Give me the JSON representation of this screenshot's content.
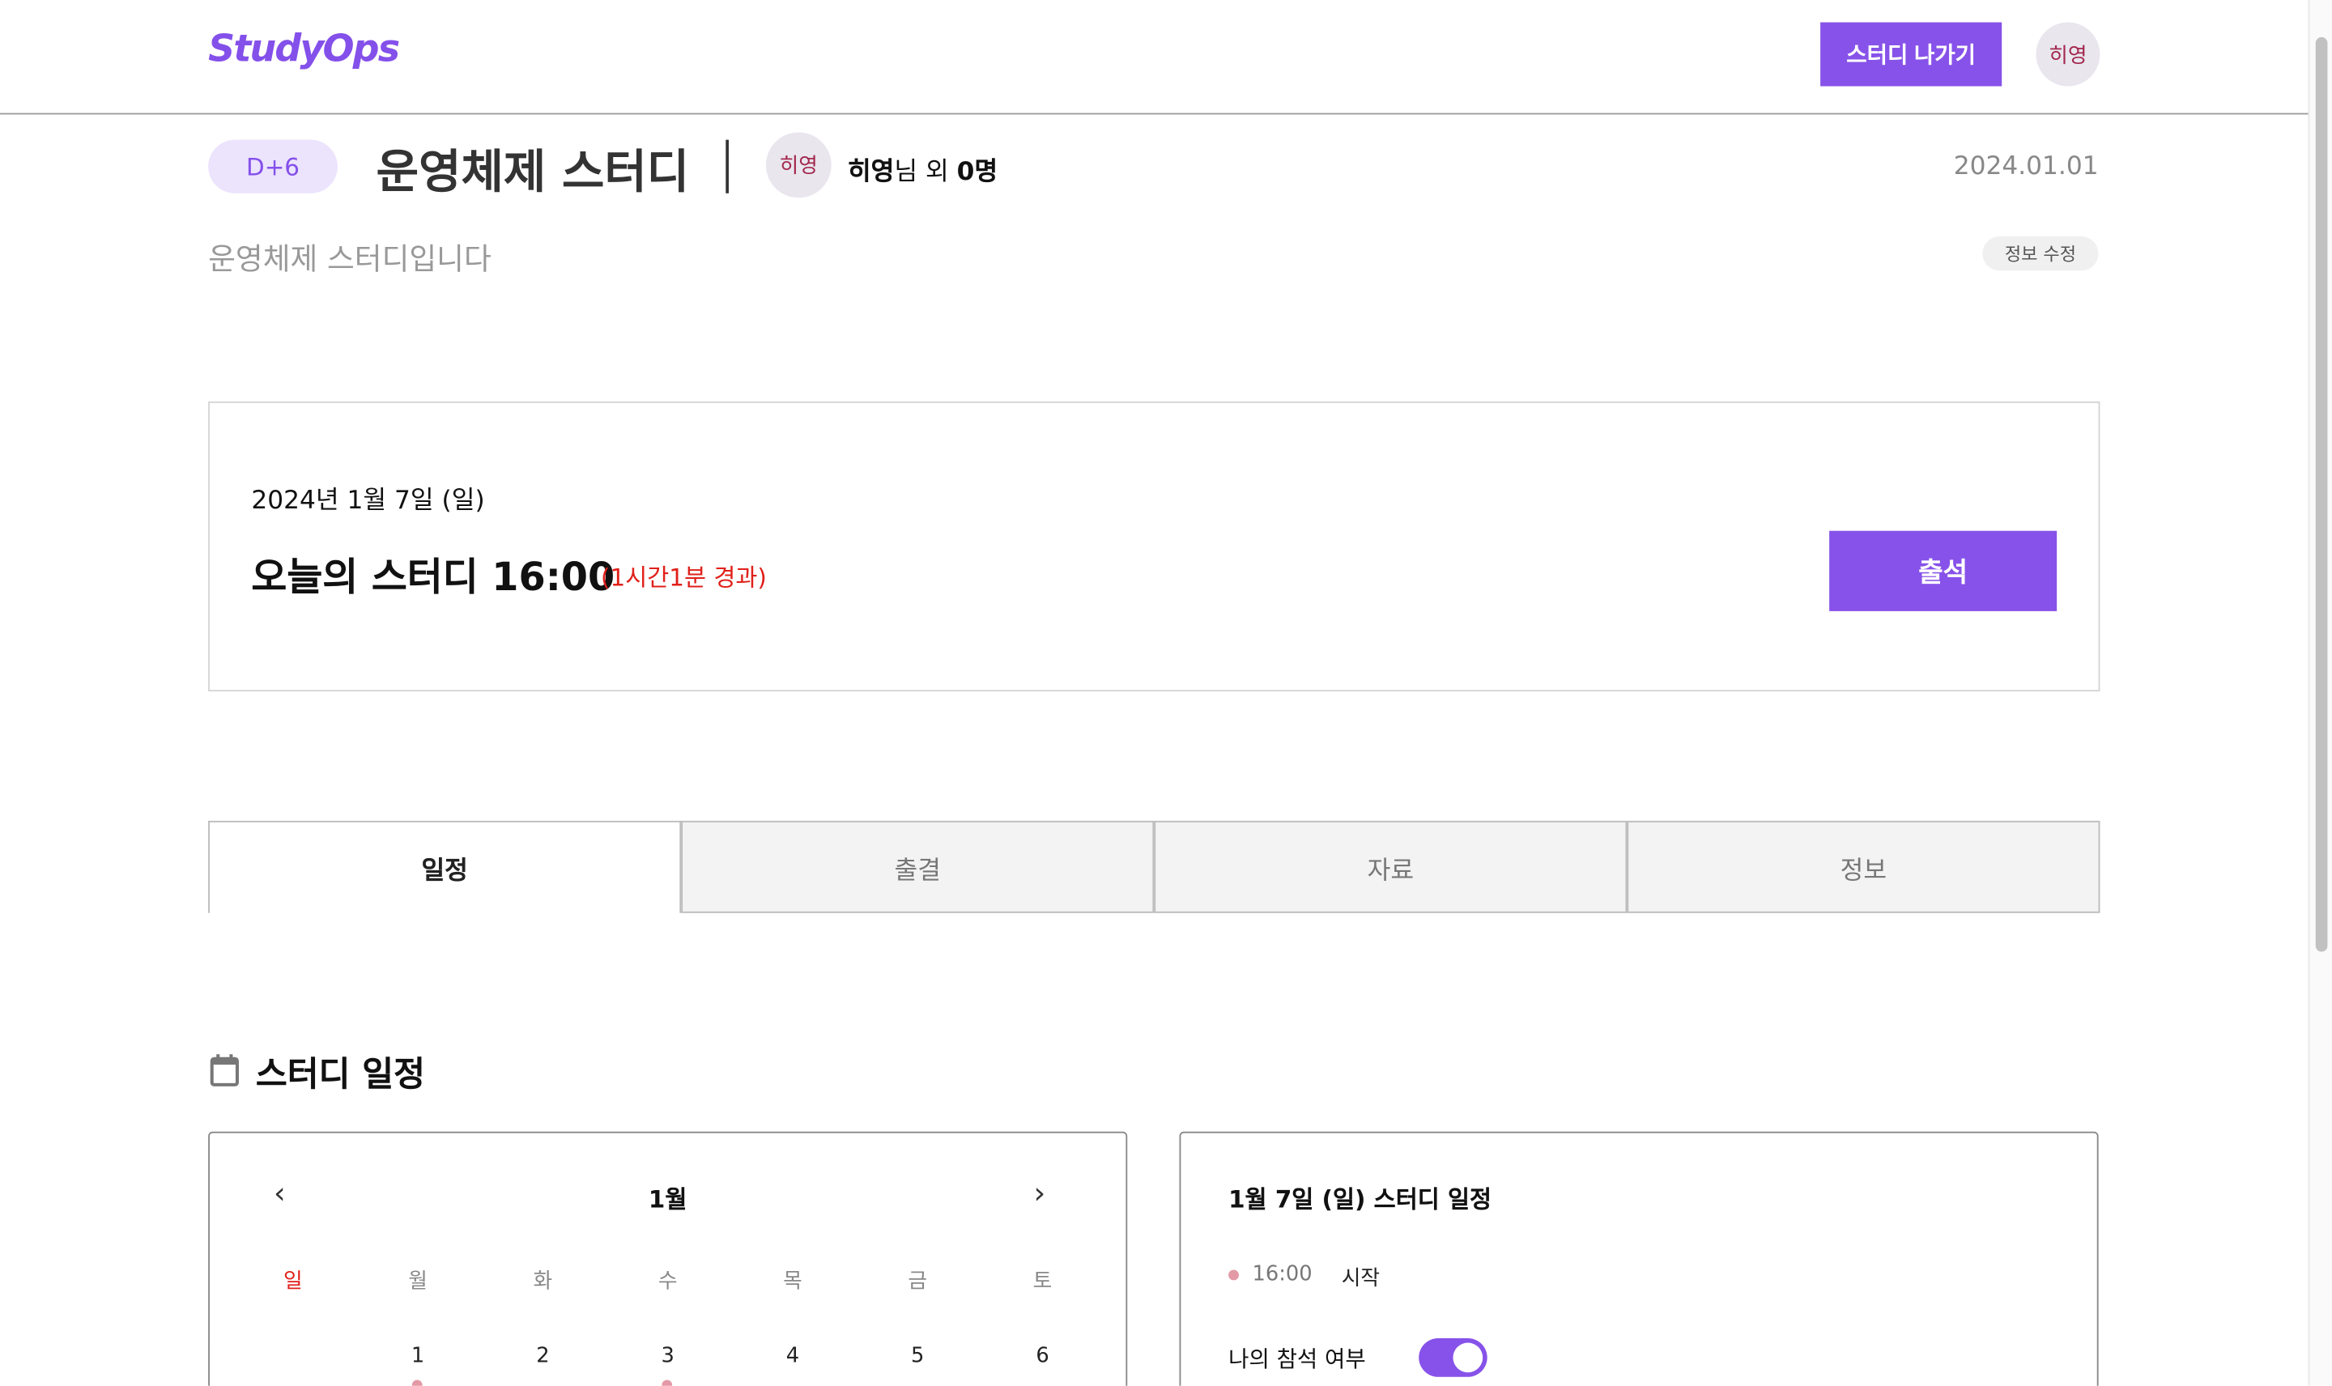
{
  "header": {
    "logo": "StudyOps",
    "leave_button": "스터디 나가기",
    "avatar": "히영"
  },
  "study": {
    "dday": "D+6",
    "title": "운영체제 스터디",
    "member_avatar": "히영",
    "member_name": "히영",
    "member_suffix": "님 외 ",
    "member_count": "0명",
    "created_date": "2024.01.01",
    "description": "운영체제 스터디입니다",
    "edit_button": "정보 수정"
  },
  "today": {
    "date": "2024년 1월 7일 (일)",
    "title": "오늘의 스터디 16:00",
    "elapsed": "(1시간1분 경과)",
    "attend_button": "출석"
  },
  "tabs": [
    {
      "label": "일정"
    },
    {
      "label": "출결"
    },
    {
      "label": "자료"
    },
    {
      "label": "정보"
    }
  ],
  "schedule": {
    "heading": "스터디 일정",
    "icon": "calendar-icon"
  },
  "calendar": {
    "month": "1월",
    "weekdays": [
      "일",
      "월",
      "화",
      "수",
      "목",
      "금",
      "토"
    ],
    "days": [
      "1",
      "2",
      "3",
      "4",
      "5",
      "6"
    ],
    "event_days": [
      "1",
      "3"
    ]
  },
  "detail": {
    "title": "1월 7일 (일) 스터디 일정",
    "event_time": "16:00",
    "event_label": "시작",
    "attend_label": "나의 참석 여부",
    "attend_toggle_on": true
  },
  "colors": {
    "accent": "#8752e9",
    "sunday": "#e0201a",
    "elapsed": "#e0201a",
    "event_dot": "#e39aa6"
  }
}
